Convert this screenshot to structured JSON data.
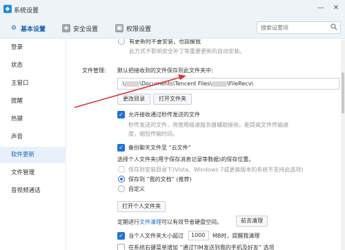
{
  "window": {
    "title": "系统设置"
  },
  "tabs": [
    {
      "label": "基本设置"
    },
    {
      "label": "安全设置"
    },
    {
      "label": "权限设置"
    }
  ],
  "search": {
    "placeholder": "搜索设置项"
  },
  "sidebar": {
    "items": [
      {
        "label": "登录"
      },
      {
        "label": "状态"
      },
      {
        "label": "主窗口"
      },
      {
        "label": "提醒"
      },
      {
        "label": "热键"
      },
      {
        "label": "声音"
      },
      {
        "label": "软件更新"
      },
      {
        "label": "文件管理"
      },
      {
        "label": "音视频通话"
      }
    ],
    "active_index": 6
  },
  "content": {
    "top_option_partial": "有更新时不要安装，也提醒我",
    "top_option_desc": "此方式不影响安全补丁等重要更新的自动安装。",
    "file_mgmt_label": "文件管理:",
    "default_save_desc": "默认把接收到的文件保存到此文件夹中:",
    "path_part1": ".\\",
    "path_part2": "\\Documents\\Tencent Files\\",
    "path_part3": "\\FileRecv\\",
    "change_dir_button": "更改目录",
    "open_folder_button": "打开文件夹",
    "allow_second_transfer": "允许接收通过秒传发送的文件",
    "second_transfer_desc_1": "秒传发送的文件，将使用极速服务器辅助接收。能提高文件传输速",
    "second_transfer_desc_2": "度，缩短传输时间。",
    "backup_label": "备份聊天文件至 “云文件”",
    "choose_folder_desc": "选择个人文件夹(用于保存消息记录等数据)的保存位置。",
    "radio_install_dir": "保存到安装目录下(Vista、Windows 7或更高版本的系统不支持此选项)",
    "radio_my_docs": "保存到 “我的文档” (推荐)",
    "radio_custom": "自定义",
    "open_personal_folder_button": "打开个人文件夹",
    "cleanup_prefix": "定期进行",
    "cleanup_link": "文件清理",
    "cleanup_suffix": "可以有效节省硬盘空间。",
    "go_cleanup_button": "前去清理",
    "size_limit_prefix": "当个人文件夹大小超过",
    "size_limit_value": "1000",
    "size_limit_suffix": "MB时，提醒我清理",
    "bottom_partial": "在系统右键菜单增加 “通过TIM发送到我的手机及好友” 选项"
  },
  "colors": {
    "accent": "#1c75d4",
    "active_tab": "#1464b4",
    "link": "#1c6fc7"
  },
  "icons": [
    "app-icon",
    "gear-icon",
    "shield-icon",
    "lock-icon",
    "search-icon",
    "minimize-icon",
    "close-icon",
    "check-icon"
  ]
}
